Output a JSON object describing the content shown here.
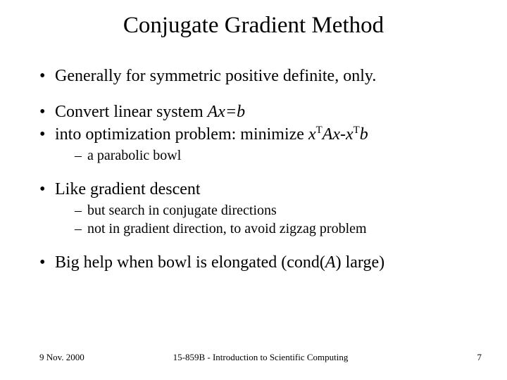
{
  "title": "Conjugate Gradient Method",
  "bullets": {
    "b0": "Generally for symmetric positive definite, only.",
    "b1_pre": "Convert linear system  ",
    "b1_math": "Ax=b",
    "b2_pre": "into optimization problem: minimize  ",
    "b2_m1": "x",
    "b2_s1": "T",
    "b2_m2": "Ax-x",
    "b2_s2": "T",
    "b2_m3": "b",
    "b2_sub0": "a parabolic bowl",
    "b3": "Like gradient descent",
    "b3_sub0": "but search in conjugate directions",
    "b3_sub1": "not in gradient direction, to avoid zigzag problem",
    "b4_pre": "Big help when bowl is elongated (cond(",
    "b4_mathA": "A",
    "b4_post": ") large)"
  },
  "footer": {
    "left": "9 Nov. 2000",
    "center": "15-859B - Introduction to Scientific Computing",
    "right": "7"
  }
}
